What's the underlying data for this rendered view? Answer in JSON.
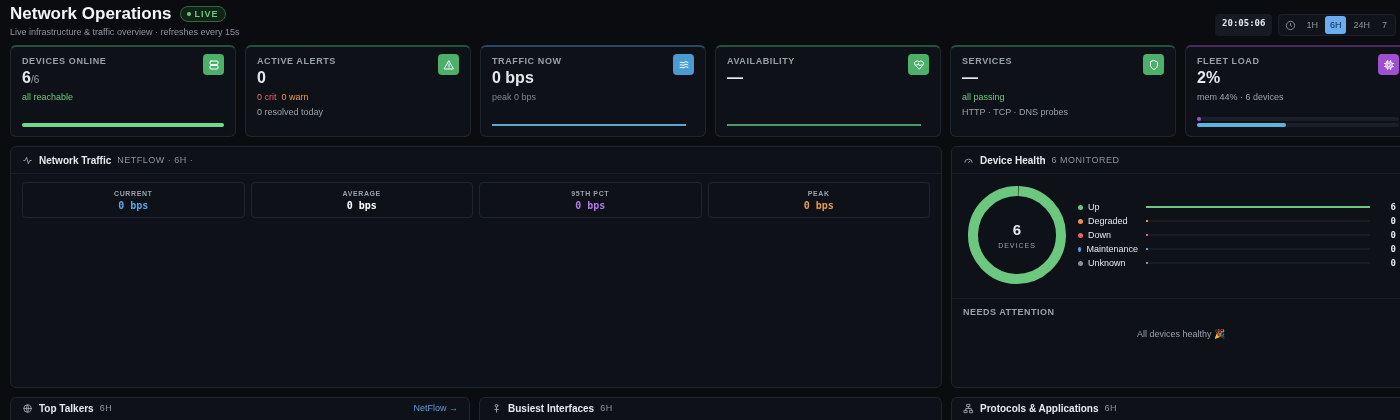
{
  "header": {
    "title": "Network Operations",
    "badge": "LIVE",
    "subtitle": "Live infrastructure & traffic overview · refreshes every 15s",
    "clock": "20:05:06",
    "ranges": [
      {
        "label": "1H",
        "selected": false
      },
      {
        "label": "6H",
        "selected": true
      },
      {
        "label": "24H",
        "selected": false
      },
      {
        "label": "7",
        "selected": false
      }
    ]
  },
  "kpis": [
    {
      "label": "DEVICES ONLINE",
      "value": "6",
      "suffix": "/6",
      "color": "#4caf6a",
      "lines": [
        [
          {
            "text": "all reachable",
            "kind": "good"
          }
        ]
      ],
      "footer": {
        "kind": "bar",
        "bars": [
          {
            "level": 1,
            "color": "#6fd98a"
          }
        ]
      }
    },
    {
      "label": "ACTIVE ALERTS",
      "value": "0",
      "color": "#4caf6a",
      "lines": [
        [
          {
            "text": "0 crit",
            "kind": "bad"
          },
          {
            "text": "0 warn",
            "kind": "warn"
          }
        ],
        [
          {
            "text": "0 resolved today",
            "kind": "muted"
          }
        ]
      ]
    },
    {
      "label": "TRAFFIC NOW",
      "value": "0 bps",
      "color": "#4a9bd1",
      "lines": [
        [
          {
            "text": "peak 0 bps",
            "kind": "dim"
          }
        ]
      ],
      "footer": {
        "kind": "line",
        "color": "#5aa7cf"
      }
    },
    {
      "label": "AVAILABILITY",
      "value": "—",
      "color": "#4caf6a",
      "footer": {
        "kind": "line",
        "color": "#4f9a6c"
      }
    },
    {
      "label": "SERVICES",
      "value": "—",
      "color": "#4caf6a",
      "lines": [
        [
          {
            "text": "all passing",
            "kind": "good"
          }
        ],
        [
          {
            "text": "HTTP · TCP · DNS probes",
            "kind": "muted"
          }
        ]
      ]
    },
    {
      "label": "FLEET LOAD",
      "value": "2%",
      "color": "#a04fd0",
      "lines": [
        [
          {
            "text": "mem 44% · 6 devices",
            "kind": "muted"
          }
        ]
      ],
      "footer": {
        "kind": "bar",
        "bars": [
          {
            "level": 0.02,
            "color": "#a04fd0"
          },
          {
            "level": 0.44,
            "color": "#5ab4e0"
          }
        ]
      }
    }
  ],
  "traffic": {
    "title": "Network Traffic",
    "meta": "NETFLOW · 6H ·",
    "stats": [
      {
        "label": "CURRENT",
        "value": "0 bps",
        "color": "#5aa7e6"
      },
      {
        "label": "AVERAGE",
        "value": "0 bps",
        "color": "#ffffff"
      },
      {
        "label": "95TH PCT",
        "value": "0 bps",
        "color": "#b07ae8"
      },
      {
        "label": "PEAK",
        "value": "0 bps",
        "color": "#e89a4a"
      }
    ]
  },
  "health": {
    "title": "Device Health",
    "meta": "6 MONITORED",
    "total": "6",
    "total_label": "DEVICES",
    "items": [
      {
        "label": "Up",
        "count": "6",
        "level": 1,
        "color": "#6cc77f"
      },
      {
        "label": "Degraded",
        "count": "0",
        "level": 0,
        "color": "#e8934a"
      },
      {
        "label": "Down",
        "count": "0",
        "level": 0,
        "color": "#e8646a"
      },
      {
        "label": "Maintenance",
        "count": "0",
        "level": 0,
        "color": "#4aa3e8"
      },
      {
        "label": "Unknown",
        "count": "0",
        "level": 0,
        "color": "#8a9099"
      }
    ],
    "attention_title": "NEEDS ATTENTION",
    "attention_text": "All devices healthy 🎉"
  },
  "bottom": [
    {
      "title": "Top Talkers",
      "meta": "6H",
      "link": "NetFlow →"
    },
    {
      "title": "Busiest Interfaces",
      "meta": "6H"
    },
    {
      "title": "Protocols & Applications",
      "meta": "6H"
    }
  ]
}
